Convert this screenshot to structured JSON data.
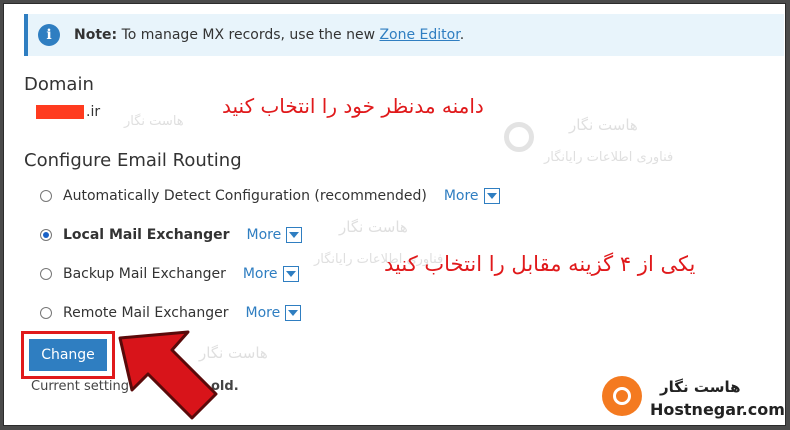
{
  "note": {
    "label": "Note:",
    "text": "To manage MX records, use the new",
    "link": "Zone Editor",
    "end": "."
  },
  "domain": {
    "heading": "Domain",
    "tld": ".ir"
  },
  "routing": {
    "heading": "Configure Email Routing",
    "options": [
      {
        "label": "Automatically Detect Configuration (recommended)",
        "selected": false
      },
      {
        "label": "Local Mail Exchanger",
        "selected": true
      },
      {
        "label": "Backup Mail Exchanger",
        "selected": false
      },
      {
        "label": "Remote Mail Exchanger",
        "selected": false
      }
    ],
    "more_label": "More"
  },
  "button": {
    "change": "Change"
  },
  "current": {
    "prefix": "Current setting",
    "suffix": "old."
  },
  "annotations": {
    "select_domain": "دامنه مدنظر خود را انتخاب کنید",
    "select_option": "یکی از ۴ گزینه مقابل را انتخاب کنید"
  },
  "watermark": {
    "brand": "هاست نگار",
    "tagline": "فناوری اطلاعات رایانگار"
  },
  "branding": {
    "fa": "هاست نگار",
    "en": "Hostnegar.com"
  },
  "colors": {
    "accent": "#2f7ec1",
    "annotation": "#e0191b",
    "logo": "#f47a20"
  },
  "icons": {
    "info": "info-icon",
    "caret": "caret-down-icon",
    "arrow": "red-arrow",
    "logo": "hostnegar-logo"
  }
}
